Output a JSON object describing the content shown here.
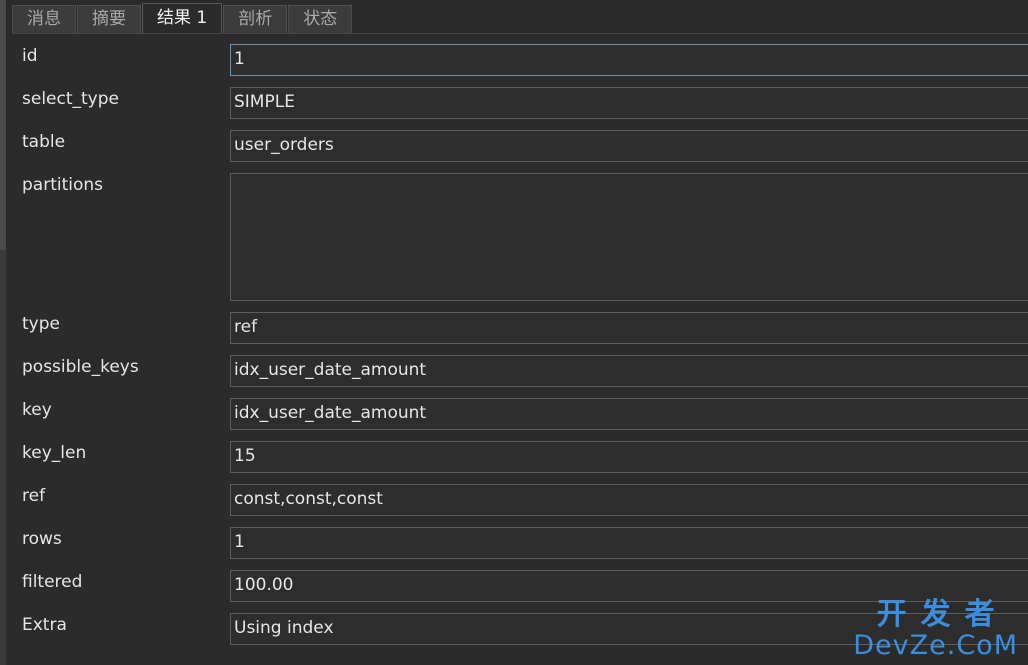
{
  "tabs": [
    {
      "label": "消息",
      "active": false
    },
    {
      "label": "摘要",
      "active": false
    },
    {
      "label": "结果 1",
      "active": true
    },
    {
      "label": "剖析",
      "active": false
    },
    {
      "label": "状态",
      "active": false
    }
  ],
  "fields": [
    {
      "label": "id",
      "value": "1"
    },
    {
      "label": "select_type",
      "value": "SIMPLE"
    },
    {
      "label": "table",
      "value": "user_orders"
    },
    {
      "label": "partitions",
      "value": ""
    },
    {
      "label": "type",
      "value": "ref"
    },
    {
      "label": "possible_keys",
      "value": "idx_user_date_amount"
    },
    {
      "label": "key",
      "value": "idx_user_date_amount"
    },
    {
      "label": "key_len",
      "value": "15"
    },
    {
      "label": "ref",
      "value": "const,const,const"
    },
    {
      "label": "rows",
      "value": "1"
    },
    {
      "label": "filtered",
      "value": "100.00"
    },
    {
      "label": "Extra",
      "value": "Using index"
    }
  ],
  "watermark": {
    "top": "开发者",
    "bottom": "DevZe.CoM"
  },
  "colors": {
    "background": "#2b2b2b",
    "field_border": "#5c5c5c",
    "watermark": "#3b8ede"
  }
}
